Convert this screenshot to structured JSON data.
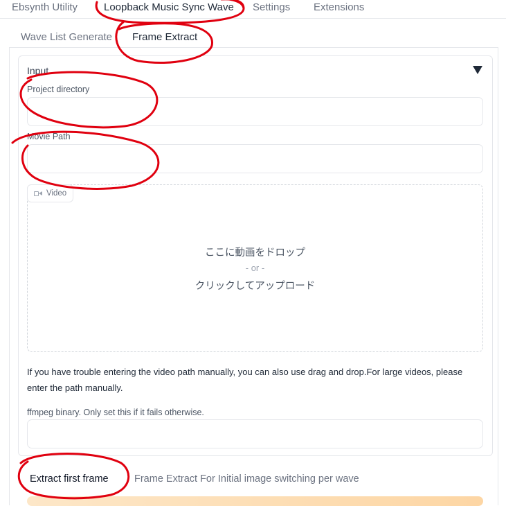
{
  "top_tabs": [
    {
      "label": "Ebsynth Utility"
    },
    {
      "label": "Loopback Music Sync Wave"
    },
    {
      "label": "Settings"
    },
    {
      "label": "Extensions"
    }
  ],
  "sub_tabs": [
    {
      "label": "Wave List Generate"
    },
    {
      "label": "Frame Extract"
    }
  ],
  "input_section": {
    "title": "Input",
    "project_directory": {
      "label": "Project directory",
      "value": ""
    },
    "movie_path": {
      "label": "Movie Path",
      "value": ""
    },
    "video": {
      "badge_label": "Video",
      "drop_line1": "ここに動画をドロップ",
      "drop_or": "- or -",
      "drop_line2": "クリックしてアップロード"
    },
    "info": "If you have trouble entering the video path manually, you can also use drag and drop.For large videos, please enter the path manually.",
    "ffmpeg": {
      "label": "ffmpeg binary. Only set this if it fails otherwise.",
      "value": ""
    }
  },
  "bottom_tabs": [
    {
      "label": "Extract first frame"
    },
    {
      "label": "Frame Extract For Initial image switching per wave"
    }
  ],
  "colors": {
    "annotation_red": "#e0000f",
    "accent_orange": "#fdd6a4"
  }
}
